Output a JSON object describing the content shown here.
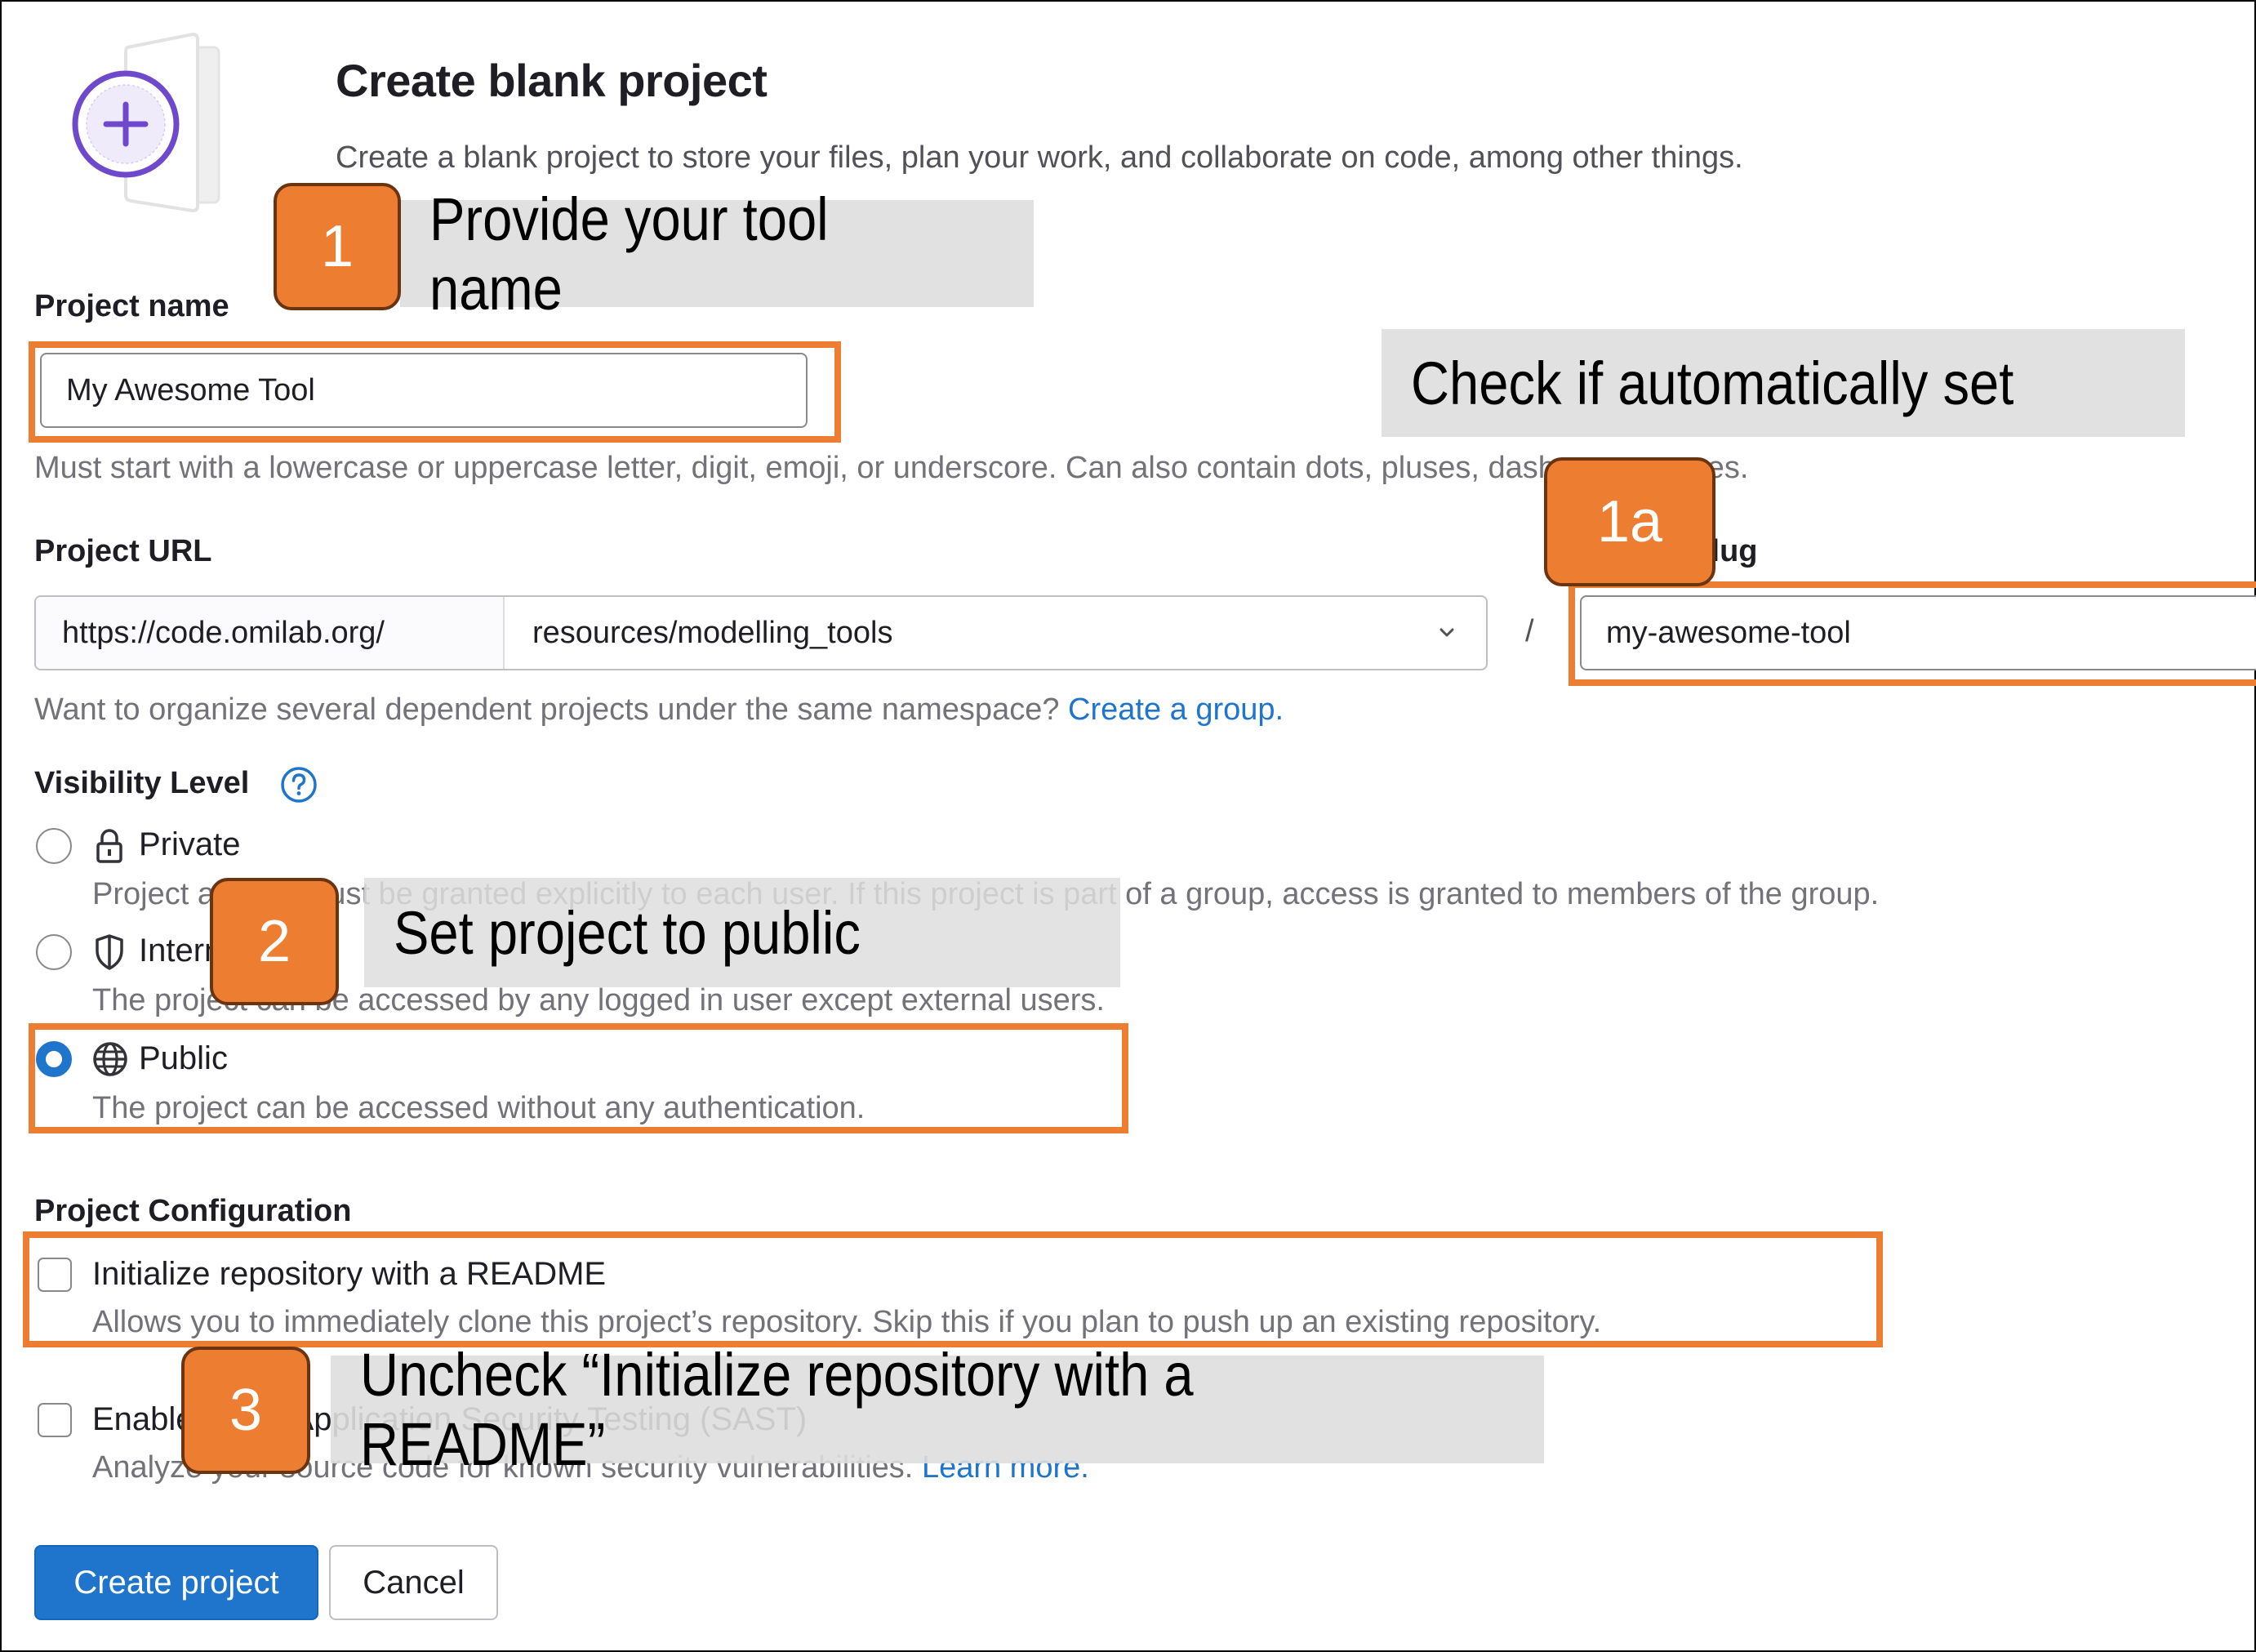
{
  "header": {
    "title": "Create blank project",
    "subtitle": "Create a blank project to store your files, plan your work, and collaborate on code, among other things.",
    "illustration": "blank-project-plus-icon"
  },
  "project_name": {
    "label": "Project name",
    "value": "My Awesome Tool",
    "help": "Must start with a lowercase or uppercase letter, digit, emoji, or underscore. Can also contain dots, pluses, dashes, or spaces."
  },
  "project_url": {
    "label": "Project URL",
    "prefix": "https://code.omilab.org/",
    "namespace": "resources/modelling_tools",
    "separator": "/",
    "help_text": "Want to organize several dependent projects under the same namespace?",
    "help_link": "Create a group."
  },
  "project_slug": {
    "label": "Project slug",
    "value": "my-awesome-tool"
  },
  "visibility": {
    "label": "Visibility Level",
    "help_icon": "question-circle-icon",
    "options": [
      {
        "label": "Private",
        "icon": "lock-icon",
        "description": "Project access must be granted explicitly to each user. If this project is part of a group, access is granted to members of the group.",
        "selected": false
      },
      {
        "label": "Internal",
        "icon": "shield-icon",
        "description": "The project can be accessed by any logged in user except external users.",
        "selected": false
      },
      {
        "label": "Public",
        "icon": "globe-icon",
        "description": "The project can be accessed without any authentication.",
        "selected": true
      }
    ]
  },
  "configuration": {
    "label": "Project Configuration",
    "options": [
      {
        "label": "Initialize repository with a README",
        "description": "Allows you to immediately clone this project’s repository. Skip this if you plan to push up an existing repository.",
        "checked": false
      },
      {
        "label": "Enable Static Application Security Testing (SAST)",
        "description": "Analyze your source code for known security vulnerabilities.",
        "link": "Learn more.",
        "checked": false
      }
    ]
  },
  "actions": {
    "create_label": "Create project",
    "cancel_label": "Cancel"
  },
  "annotations": {
    "step1_badge": "1",
    "step1_text": "Provide your tool name",
    "step1a_badge": "1a",
    "step1a_text": "Check if automatically set",
    "step2_badge": "2",
    "step2_text": "Set project to public",
    "step3_badge": "3",
    "step3_text": "Uncheck “Initialize repository with a README”"
  },
  "colors": {
    "annotation_orange": "#ED7D31",
    "annotation_border": "#6B3410",
    "callout_gray": "#DEDEDE",
    "primary_blue": "#1F75CB",
    "illustration_purple": "#6E49CB"
  }
}
